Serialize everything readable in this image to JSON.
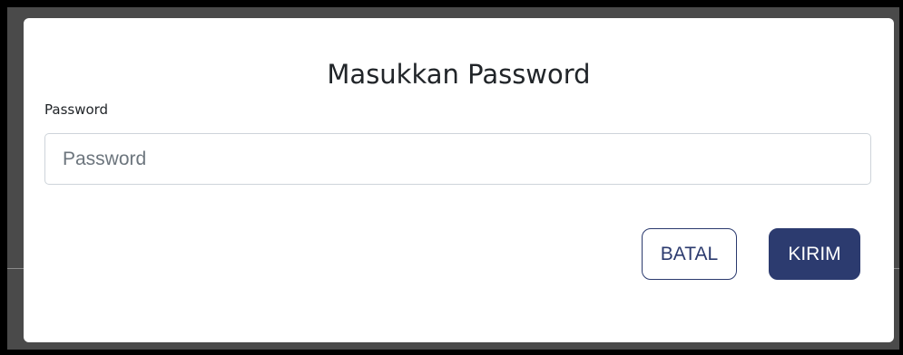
{
  "modal": {
    "title": "Masukkan Password",
    "password_label": "Password",
    "password_placeholder": "Password",
    "password_value": "",
    "cancel_label": "BATAL",
    "submit_label": "KIRIM"
  },
  "colors": {
    "primary": "#2c3b6f",
    "text": "#212529",
    "border": "#ced4da"
  }
}
